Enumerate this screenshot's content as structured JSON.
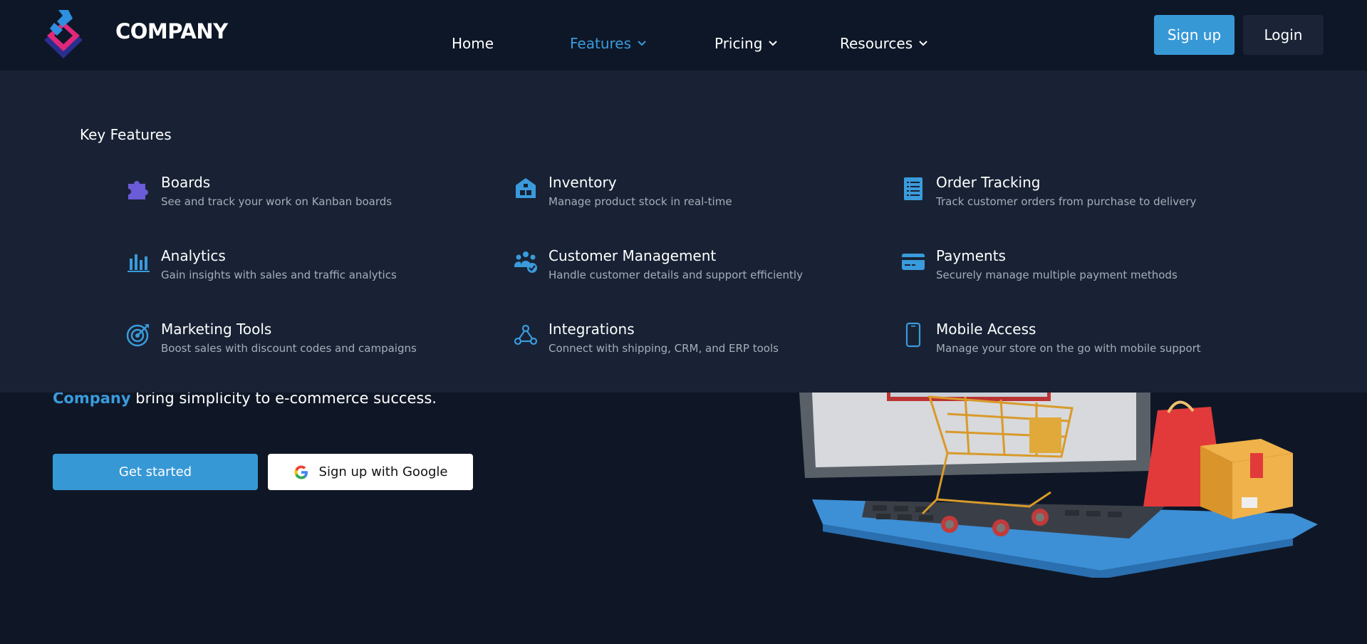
{
  "brand": {
    "name": "COMPANY",
    "logo_icon": "diamond-s-logo-icon"
  },
  "nav": {
    "links": [
      {
        "label": "Home",
        "has_chevron": false
      },
      {
        "label": "Features",
        "has_chevron": true,
        "active": true
      },
      {
        "label": "Pricing",
        "has_chevron": true
      },
      {
        "label": "Resources",
        "has_chevron": true
      }
    ],
    "signup_label": "Sign up",
    "login_label": "Login"
  },
  "dropdown": {
    "title": "Key Features",
    "features": [
      {
        "name": "Boards",
        "desc": "See and track your work on Kanban boards",
        "icon": "puzzle-icon"
      },
      {
        "name": "Inventory",
        "desc": "Manage product stock in real-time",
        "icon": "warehouse-icon"
      },
      {
        "name": "Order Tracking",
        "desc": "Track customer orders from purchase to delivery",
        "icon": "receipt-list-icon"
      },
      {
        "name": "Analytics",
        "desc": "Gain insights with sales and traffic analytics",
        "icon": "bar-chart-icon"
      },
      {
        "name": "Customer Management",
        "desc": "Handle customer details and support efficiently",
        "icon": "users-check-icon"
      },
      {
        "name": "Payments",
        "desc": "Securely manage multiple payment methods",
        "icon": "credit-card-icon"
      },
      {
        "name": "Marketing Tools",
        "desc": "Boost sales with discount codes and campaigns",
        "icon": "target-icon"
      },
      {
        "name": "Integrations",
        "desc": "Connect with shipping, CRM, and ERP tools",
        "icon": "webhook-icon"
      },
      {
        "name": "Mobile Access",
        "desc": "Manage your store on the go with mobile support",
        "icon": "smartphone-icon"
      }
    ]
  },
  "hero": {
    "highlight": "Company",
    "line_rest": " bring simplicity to e-commerce success.",
    "get_started_label": "Get started",
    "google_label": "Sign up with Google"
  },
  "colors": {
    "accent": "#3798d6",
    "bg": "#0f1726",
    "dropdown_bg": "#182234",
    "puzzle_icon": "#6b5bd6"
  }
}
